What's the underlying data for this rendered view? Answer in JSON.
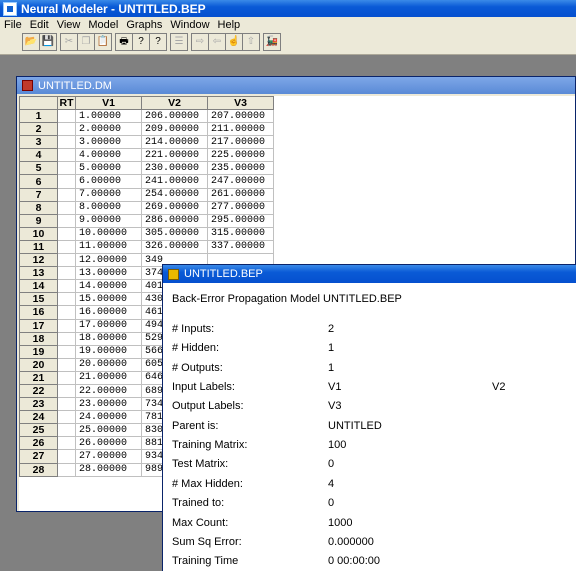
{
  "app": {
    "title": "Neural Modeler - UNTITLED.BEP"
  },
  "menu": [
    "File",
    "Edit",
    "View",
    "Model",
    "Graphs",
    "Window",
    "Help"
  ],
  "toolbar": {
    "buttons": [
      {
        "name": "open-icon",
        "glyph": "📂",
        "enabled": true
      },
      {
        "name": "save-icon",
        "glyph": "💾",
        "enabled": true
      },
      {
        "name": "cut-icon",
        "glyph": "✂",
        "enabled": false
      },
      {
        "name": "copy-icon",
        "glyph": "❐",
        "enabled": false
      },
      {
        "name": "paste-icon",
        "glyph": "📋",
        "enabled": false
      },
      {
        "name": "print-icon",
        "glyph": "🖶",
        "enabled": true
      },
      {
        "name": "help-icon",
        "glyph": "?",
        "enabled": true
      },
      {
        "name": "context-help-icon",
        "glyph": "?",
        "enabled": true
      },
      {
        "name": "list-icon",
        "glyph": "☰",
        "enabled": false
      },
      {
        "name": "forward-icon",
        "glyph": "⇨",
        "enabled": false
      },
      {
        "name": "back-icon",
        "glyph": "⇦",
        "enabled": false
      },
      {
        "name": "pointer-icon",
        "glyph": "☝",
        "enabled": false
      },
      {
        "name": "up-icon",
        "glyph": "⇧",
        "enabled": false
      },
      {
        "name": "train-icon",
        "glyph": "🚂",
        "enabled": true
      }
    ]
  },
  "dm_window": {
    "title": "UNTITLED.DM",
    "columns": [
      "",
      "RT",
      "V1",
      "V2",
      "V3"
    ],
    "rows": [
      [
        "1",
        "",
        "1.00000",
        "206.00000",
        "207.00000"
      ],
      [
        "2",
        "",
        "2.00000",
        "209.00000",
        "211.00000"
      ],
      [
        "3",
        "",
        "3.00000",
        "214.00000",
        "217.00000"
      ],
      [
        "4",
        "",
        "4.00000",
        "221.00000",
        "225.00000"
      ],
      [
        "5",
        "",
        "5.00000",
        "230.00000",
        "235.00000"
      ],
      [
        "6",
        "",
        "6.00000",
        "241.00000",
        "247.00000"
      ],
      [
        "7",
        "",
        "7.00000",
        "254.00000",
        "261.00000"
      ],
      [
        "8",
        "",
        "8.00000",
        "269.00000",
        "277.00000"
      ],
      [
        "9",
        "",
        "9.00000",
        "286.00000",
        "295.00000"
      ],
      [
        "10",
        "",
        "10.00000",
        "305.00000",
        "315.00000"
      ],
      [
        "11",
        "",
        "11.00000",
        "326.00000",
        "337.00000"
      ],
      [
        "12",
        "",
        "12.00000",
        "349",
        ""
      ],
      [
        "13",
        "",
        "13.00000",
        "374",
        ""
      ],
      [
        "14",
        "",
        "14.00000",
        "401",
        ""
      ],
      [
        "15",
        "",
        "15.00000",
        "430",
        ""
      ],
      [
        "16",
        "",
        "16.00000",
        "461",
        ""
      ],
      [
        "17",
        "",
        "17.00000",
        "494",
        ""
      ],
      [
        "18",
        "",
        "18.00000",
        "529",
        ""
      ],
      [
        "19",
        "",
        "19.00000",
        "566",
        ""
      ],
      [
        "20",
        "",
        "20.00000",
        "605",
        ""
      ],
      [
        "21",
        "",
        "21.00000",
        "646",
        ""
      ],
      [
        "22",
        "",
        "22.00000",
        "689",
        ""
      ],
      [
        "23",
        "",
        "23.00000",
        "734",
        ""
      ],
      [
        "24",
        "",
        "24.00000",
        "781",
        ""
      ],
      [
        "25",
        "",
        "25.00000",
        "830",
        ""
      ],
      [
        "26",
        "",
        "26.00000",
        "881",
        ""
      ],
      [
        "27",
        "",
        "27.00000",
        "934",
        ""
      ],
      [
        "28",
        "",
        "28.00000",
        "989",
        ""
      ]
    ]
  },
  "bep_window": {
    "title": "UNTITLED.BEP",
    "heading": "Back-Error Propagation Model UNTITLED.BEP",
    "fields": [
      {
        "label": "# Inputs:",
        "value": "2",
        "value2": ""
      },
      {
        "label": "# Hidden:",
        "value": "1",
        "value2": ""
      },
      {
        "label": "# Outputs:",
        "value": "1",
        "value2": ""
      },
      {
        "label": "Input Labels:",
        "value": "V1",
        "value2": "V2"
      },
      {
        "label": "Output Labels:",
        "value": "V3",
        "value2": ""
      },
      {
        "label": "Parent is:",
        "value": "UNTITLED",
        "value2": ""
      },
      {
        "label": "Training Matrix:",
        "value": "100",
        "value2": ""
      },
      {
        "label": "Test Matrix:",
        "value": "0",
        "value2": ""
      },
      {
        "label": "# Max Hidden:",
        "value": "4",
        "value2": ""
      },
      {
        "label": "Trained to:",
        "value": "0",
        "value2": ""
      },
      {
        "label": "Max Count:",
        "value": "1000",
        "value2": ""
      },
      {
        "label": "Sum Sq Error:",
        "value": "0.000000",
        "value2": ""
      },
      {
        "label": "Training Time",
        "value": "0 00:00:00",
        "value2": ""
      }
    ]
  }
}
